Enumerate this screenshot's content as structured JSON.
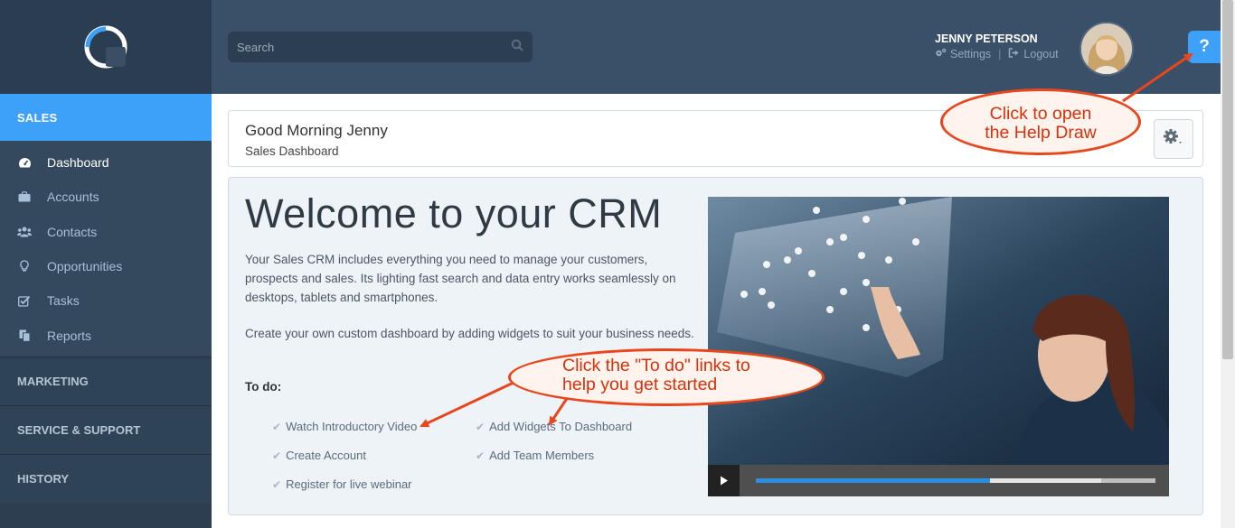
{
  "sidebar": {
    "active_section": "SALES",
    "items": [
      {
        "label": "Dashboard",
        "icon": "dashboard-icon"
      },
      {
        "label": "Accounts",
        "icon": "briefcase-icon"
      },
      {
        "label": "Contacts",
        "icon": "users-icon"
      },
      {
        "label": "Opportunities",
        "icon": "lightbulb-icon"
      },
      {
        "label": "Tasks",
        "icon": "checkbox-icon"
      },
      {
        "label": "Reports",
        "icon": "copy-icon"
      }
    ],
    "sections": [
      "MARKETING",
      "SERVICE & SUPPORT",
      "HISTORY"
    ]
  },
  "header": {
    "search_placeholder": "Search",
    "user_name": "JENNY PETERSON",
    "settings_label": "Settings",
    "logout_label": "Logout",
    "help_label": "?"
  },
  "greeting": {
    "title": "Good Morning Jenny",
    "subtitle": "Sales Dashboard"
  },
  "welcome": {
    "title": "Welcome to your CRM",
    "p1": "Your Sales CRM includes everything you need to manage your customers, prospects and sales. Its lighting fast search and data entry works seamlessly on desktops, tablets and smartphones.",
    "p2": "Create your own custom dashboard by adding widgets to suit your business needs.",
    "todo_label": "To do:",
    "todos": [
      "Watch Introductory Video",
      "Add Widgets To Dashboard",
      "Create Account",
      "Add Team Members",
      "Register for live webinar"
    ]
  },
  "video": {
    "progress": 0.586,
    "buffered": 0.865
  },
  "callouts": {
    "help": [
      "Click to open",
      "the Help Draw"
    ],
    "todo": [
      "Click the \"To do\" links to",
      "help you get started"
    ]
  },
  "colors": {
    "accent": "#3da1f9",
    "sidebar": "#2c3e50",
    "header": "#3a5068",
    "callout": "#e8461c"
  }
}
